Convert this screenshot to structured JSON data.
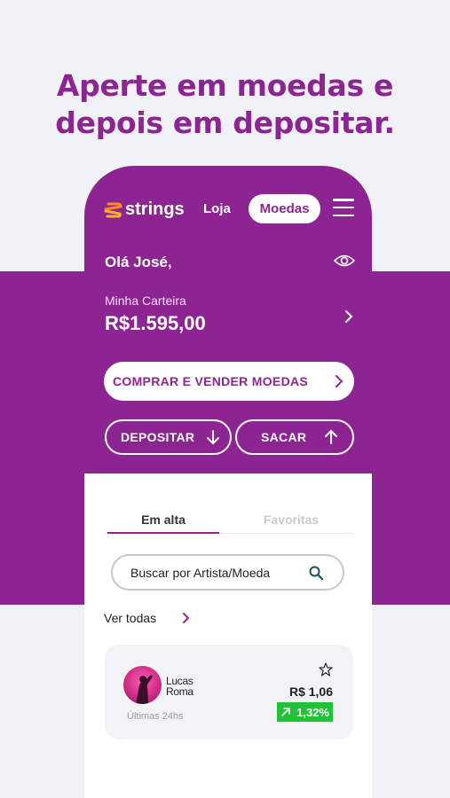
{
  "headline": [
    "Aperte em moedas e",
    "depois em depositar."
  ],
  "header": {
    "logo": "strings",
    "nav_loja": "Loja",
    "nav_moedas": "Moedas"
  },
  "greeting": "Olá José,",
  "wallet": {
    "label": "Minha Carteira",
    "value": "R$1.595,00"
  },
  "actions": {
    "buy_sell": "COMPRAR E VENDER MOEDAS",
    "deposit": "DEPOSITAR",
    "withdraw": "SACAR"
  },
  "tabs": {
    "trending": "Em alta",
    "favorites": "Favoritas"
  },
  "search": {
    "placeholder": "Buscar por Artista/Moeda"
  },
  "see_all": "Ver todas",
  "card": {
    "artist": "Lucas Roma",
    "period": "Últimas 24hs",
    "price": "R$ 1,06",
    "change": "1,32%"
  },
  "colors": {
    "brand_purple": "#8c2592",
    "positive_green": "#23c13a",
    "background": "#f1f1f8"
  }
}
